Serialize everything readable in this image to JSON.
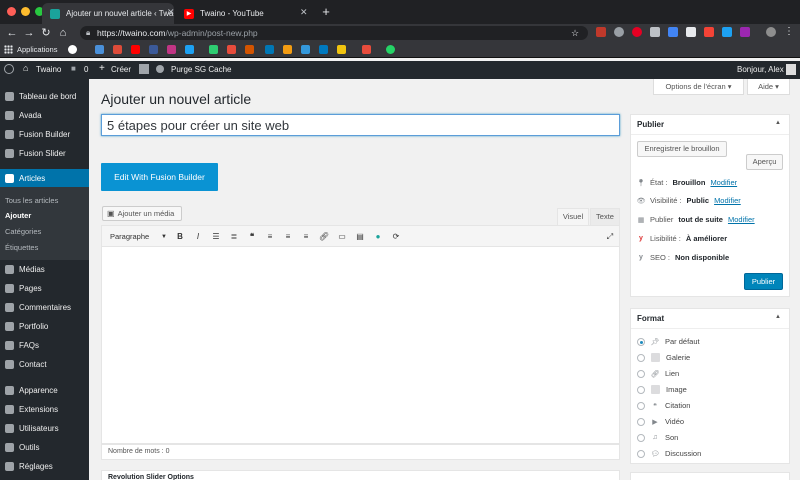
{
  "browser": {
    "tabs": [
      {
        "title": "Ajouter un nouvel article ‹ Twa",
        "active": true
      },
      {
        "title": "Twaino - YouTube",
        "active": false
      }
    ],
    "url_host": "https://twaino.com",
    "url_path": "/wp-admin/post-new.php",
    "bookmarks_label": "Applications",
    "colors": {
      "chrome_dark": "#202124",
      "chrome_toolbar": "#35363a"
    }
  },
  "adminbar": {
    "site_name": "Twaino",
    "comments_count": "0",
    "new_label": "Créer",
    "purge_label": "Purge SG Cache",
    "greeting": "Bonjour, Alex"
  },
  "sidebar": {
    "items": [
      {
        "label": "Tableau de bord",
        "icon": "dashboard-icon"
      },
      {
        "label": "Avada",
        "icon": "avada-icon"
      },
      {
        "label": "Fusion Builder",
        "icon": "fusion-icon"
      },
      {
        "label": "Fusion Slider",
        "icon": "slider-icon"
      },
      {
        "label": "Articles",
        "icon": "pin-icon"
      },
      {
        "label": "Médias",
        "icon": "media-icon"
      },
      {
        "label": "Pages",
        "icon": "pages-icon"
      },
      {
        "label": "Commentaires",
        "icon": "comments-icon"
      },
      {
        "label": "Portfolio",
        "icon": "portfolio-icon"
      },
      {
        "label": "FAQs",
        "icon": "faq-icon"
      },
      {
        "label": "Contact",
        "icon": "contact-icon"
      },
      {
        "label": "Apparence",
        "icon": "appearance-icon"
      },
      {
        "label": "Extensions",
        "icon": "plugins-icon"
      },
      {
        "label": "Utilisateurs",
        "icon": "users-icon"
      },
      {
        "label": "Outils",
        "icon": "tools-icon"
      },
      {
        "label": "Réglages",
        "icon": "settings-icon"
      }
    ],
    "submenu": [
      "Tous les articles",
      "Ajouter",
      "Catégories",
      "Étiquettes"
    ],
    "colors": {
      "bg": "#23282d",
      "active": "#0073aa"
    }
  },
  "main": {
    "screen_options": "Options de l'écran",
    "help": "Aide",
    "page_title": "Ajouter un nouvel article",
    "post_title": "5 étapes pour créer un site web",
    "fusion_button": "Edit With Fusion Builder",
    "add_media": "Ajouter un média",
    "tab_visual": "Visuel",
    "tab_text": "Texte",
    "format_select": "Paragraphe",
    "word_count": "Nombre de mots : 0",
    "next_box_title": "Revolution Slider Options"
  },
  "publish": {
    "title": "Publier",
    "save_draft": "Enregistrer le brouillon",
    "preview": "Aperçu",
    "status_label": "État :",
    "status_value": "Brouillon",
    "visibility_label": "Visibilité :",
    "visibility_value": "Public",
    "schedule_label": "Publier",
    "schedule_value": "tout de suite",
    "edit": "Modifier",
    "readability_label": "Lisibilité :",
    "readability_value": "À améliorer",
    "seo_label": "SEO :",
    "seo_value": "Non disponible",
    "publish_button": "Publier"
  },
  "format": {
    "title": "Format",
    "options": [
      "Par défaut",
      "Galerie",
      "Lien",
      "Image",
      "Citation",
      "Vidéo",
      "Son",
      "Discussion"
    ],
    "selected": "Par défaut"
  }
}
